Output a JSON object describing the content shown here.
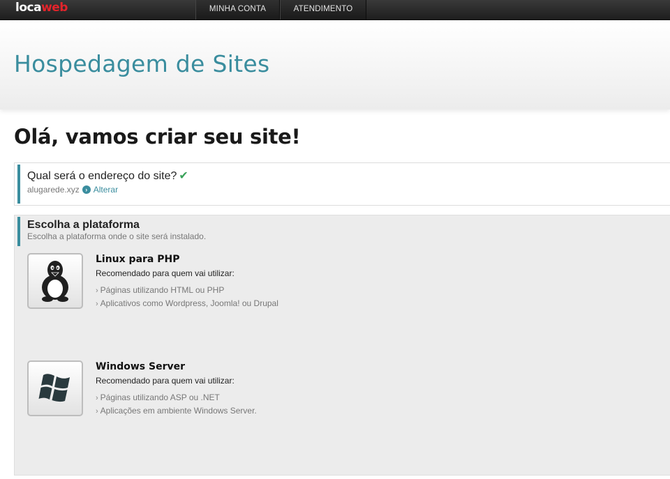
{
  "topbar": {
    "logo_left": "loca",
    "logo_mid": "w",
    "logo_right": "eb",
    "nav": [
      {
        "label": "MINHA CONTA"
      },
      {
        "label": "ATENDIMENTO"
      }
    ]
  },
  "header": {
    "title": "Hospedagem de Sites"
  },
  "main": {
    "greeting": "Olá, vamos criar seu site!",
    "address": {
      "question": "Qual será o endereço do site?",
      "domain": "alugarede.xyz",
      "alter_label": "Alterar"
    },
    "platform": {
      "title": "Escolha a plataforma",
      "subtitle": "Escolha a plataforma onde o site será instalado.",
      "options": [
        {
          "name": "Linux para PHP",
          "recommended": "Recomendado para quem vai utilizar:",
          "items": [
            "Páginas utilizando HTML ou PHP",
            "Aplicativos como Wordpress, Joomla! ou Drupal"
          ]
        },
        {
          "name": "Windows Server",
          "recommended": "Recomendado para quem vai utilizar:",
          "items": [
            "Páginas utilizando ASP ou .NET",
            "Aplicações em ambiente Windows Server."
          ]
        }
      ]
    }
  },
  "colors": {
    "accent": "#3a8d9e",
    "brand_red": "#e3242b",
    "check": "#3aa25a"
  }
}
